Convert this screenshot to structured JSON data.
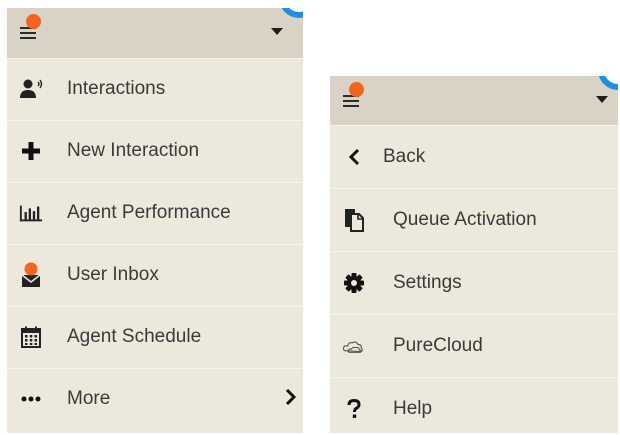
{
  "colors": {
    "panel_bg": "#ece8db",
    "header_bg": "#d9d3c5",
    "notification": "#f5631f",
    "avatar_ring": "#1e8fe1",
    "text": "#3a3a3a"
  },
  "left_menu": {
    "items": [
      {
        "label": "Interactions",
        "icon": "agent-icon"
      },
      {
        "label": "New Interaction",
        "icon": "plus-icon"
      },
      {
        "label": "Agent Performance",
        "icon": "bar-chart-icon"
      },
      {
        "label": "User Inbox",
        "icon": "inbox-icon"
      },
      {
        "label": "Agent Schedule",
        "icon": "calendar-icon"
      },
      {
        "label": "More",
        "icon": "ellipsis-icon"
      }
    ]
  },
  "right_menu": {
    "items": [
      {
        "label": "Back",
        "icon": "chevron-left-icon"
      },
      {
        "label": "Queue Activation",
        "icon": "copy-icon"
      },
      {
        "label": "Settings",
        "icon": "gear-icon"
      },
      {
        "label": "PureCloud",
        "icon": "cloud-icon"
      },
      {
        "label": "Help",
        "icon": "question-icon"
      }
    ]
  }
}
